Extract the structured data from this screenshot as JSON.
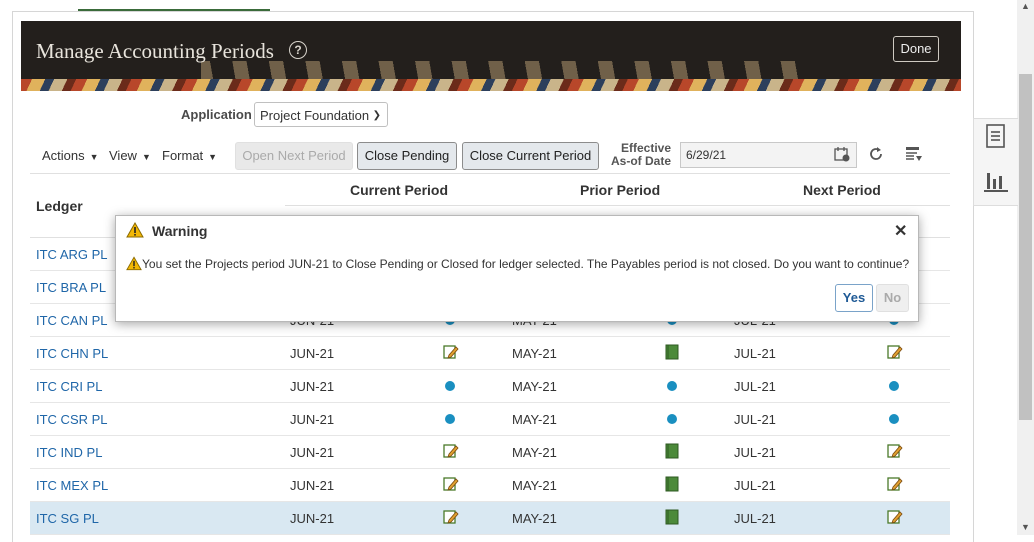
{
  "header": {
    "title": "Manage Accounting Periods",
    "help_icon": "?",
    "done_label": "Done",
    "done_accesskey_letter": "o"
  },
  "application": {
    "label": "Application",
    "value": "Project Foundation"
  },
  "toolbar": {
    "actions": "Actions",
    "view": "View",
    "format": "Format",
    "open_next_period": "Open Next Period",
    "close_pending": "Close Pending",
    "close_current_period": "Close Current Period",
    "effective_label_line1": "Effective",
    "effective_label_line2": "As-of Date",
    "effective_date": "6/29/21"
  },
  "table": {
    "headers": {
      "ledger": "Ledger",
      "current_period": "Current Period",
      "prior_period": "Prior Period",
      "next_period": "Next Period"
    },
    "rows": [
      {
        "ledger": "ITC ARG PL",
        "current": "",
        "current_status": "",
        "prior": "",
        "prior_status": "",
        "next": "",
        "next_status": ""
      },
      {
        "ledger": "ITC BRA PL",
        "current": "",
        "current_status": "",
        "prior": "",
        "prior_status": "",
        "next": "",
        "next_status": ""
      },
      {
        "ledger": "ITC CAN PL",
        "current": "JUN-21",
        "current_status": "open",
        "prior": "MAY-21",
        "prior_status": "open",
        "next": "JUL-21",
        "next_status": "open"
      },
      {
        "ledger": "ITC CHN PL",
        "current": "JUN-21",
        "current_status": "edit",
        "prior": "MAY-21",
        "prior_status": "closed",
        "next": "JUL-21",
        "next_status": "edit"
      },
      {
        "ledger": "ITC CRI PL",
        "current": "JUN-21",
        "current_status": "open",
        "prior": "MAY-21",
        "prior_status": "open",
        "next": "JUL-21",
        "next_status": "open"
      },
      {
        "ledger": "ITC CSR PL",
        "current": "JUN-21",
        "current_status": "open",
        "prior": "MAY-21",
        "prior_status": "open",
        "next": "JUL-21",
        "next_status": "open"
      },
      {
        "ledger": "ITC IND PL",
        "current": "JUN-21",
        "current_status": "edit",
        "prior": "MAY-21",
        "prior_status": "closed",
        "next": "JUL-21",
        "next_status": "edit"
      },
      {
        "ledger": "ITC MEX PL",
        "current": "JUN-21",
        "current_status": "edit",
        "prior": "MAY-21",
        "prior_status": "closed",
        "next": "JUL-21",
        "next_status": "edit"
      },
      {
        "ledger": "ITC SG PL",
        "current": "JUN-21",
        "current_status": "edit",
        "prior": "MAY-21",
        "prior_status": "closed",
        "next": "JUL-21",
        "next_status": "edit"
      }
    ]
  },
  "dialog": {
    "title": "Warning",
    "message": "You set the Projects period JUN-21 to Close Pending or Closed for ledger selected. The Payables period is not closed. Do you want to continue?",
    "yes_label": "Yes",
    "no_label": "No",
    "close_icon": "✕"
  },
  "colors": {
    "banner": "#231f1c",
    "link": "#1f66a8",
    "open_dot": "#1a8fc0",
    "selected_row": "#d9e8f2",
    "warning": "#f2b705"
  },
  "icons": {
    "side_panel": [
      "document-icon",
      "bar-chart-icon"
    ],
    "status": [
      "open-dot-icon",
      "edit-pencil-icon",
      "closed-book-icon"
    ]
  }
}
